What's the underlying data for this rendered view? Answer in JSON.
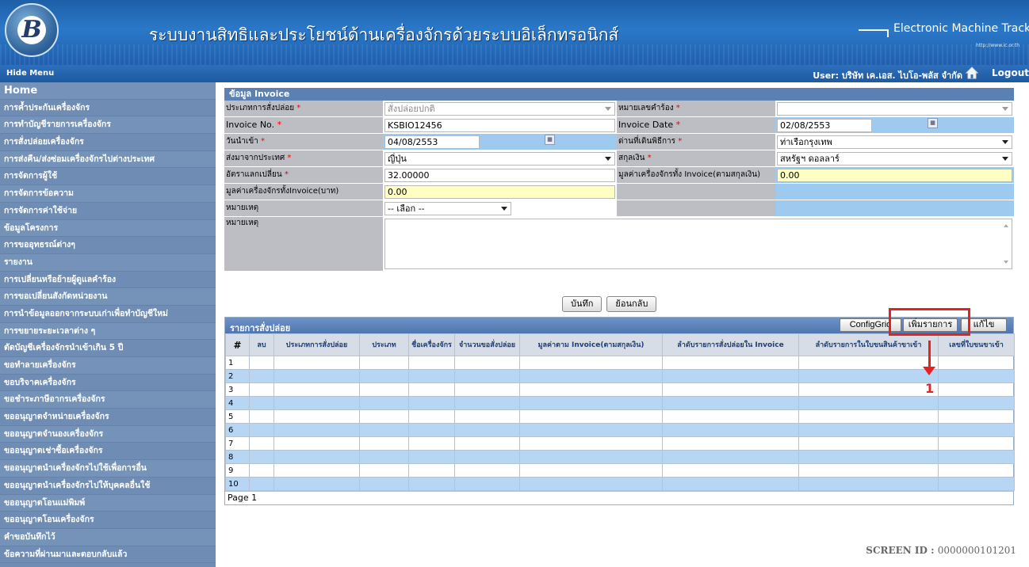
{
  "header": {
    "logo_text": "B",
    "title": "ระบบงานสิทธิและประโยชน์ด้านเครื่องจักรด้วยระบบอิเล็กทรอนิกส์",
    "brand": "Electronic Machine Tracking",
    "brand_url": "http://www.ic.or.th"
  },
  "menubar": {
    "hide_menu": "Hide Menu",
    "user": "User: บริษัท เค.เอส. ไบโอ-พลัส จำกัด",
    "logout": "Logout"
  },
  "sidebar": {
    "items": [
      "Home",
      "การค้ำประกันเครื่องจักร",
      "การทำบัญชีรายการเครื่องจักร",
      "การสั่งปล่อยเครื่องจักร",
      "การส่งคืน/ส่งซ่อมเครื่องจักรไปต่างประเทศ",
      "การจัดการผู้ใช้",
      "การจัดการข้อความ",
      "การจัดการค่าใช้จ่าย",
      "ข้อมูลโครงการ",
      "การขออุทธรณ์ต่างๆ",
      "รายงาน",
      "การเปลี่ยนหรือย้ายผู้ดูแลคำร้อง",
      "การขอเปลี่ยนสังกัดหน่วยงาน",
      "การนำข้อมูลออกจากระบบเก่าเพื่อทำบัญชีใหม่",
      "การขยายระยะเวลาต่าง ๆ",
      "ตัดบัญชีเครื่องจักรนำเข้าเกิน 5 ปี",
      "ขอทำลายเครื่องจักร",
      "ขอบริจาคเครื่องจักร",
      "ขอชำระภาษีอากรเครื่องจักร",
      "ขออนุญาตจำหน่ายเครื่องจักร",
      "ขออนุญาตจำนองเครื่องจักร",
      "ขออนุญาตเช่าซื้อเครื่องจักร",
      "ขออนุญาตนำเครื่องจักรไปใช้เพื่อการอื่น",
      "ขออนุญาตนำเครื่องจักรไปให้บุคคลอื่นใช้",
      "ขออนุญาตโอนแม่พิมพ์",
      "ขออนุญาตโอนเครื่องจักร",
      "คำขอบันทึกไว้",
      "ข้อความที่ผ่านมาและตอบกลับแล้ว"
    ]
  },
  "form": {
    "title": "ข้อมูล Invoice",
    "release_type_label": "ประเภทการสั่งปล่อย",
    "release_type_value": "สั่งปล่อยปกติ",
    "request_no_label": "หมายเลขคำร้อง",
    "request_no_value": "",
    "invoice_no_label": "Invoice No.",
    "invoice_no_value": "KSBIO12456",
    "invoice_date_label": "Invoice Date",
    "invoice_date_value": "02/08/2553",
    "import_date_label": "วันนำเข้า",
    "import_date_value": "04/08/2553",
    "customs_label": "ด่านที่เดินพิธีการ",
    "customs_value": "ท่าเรือกรุงเทพ",
    "from_country_label": "ส่งมาจากประเทศ",
    "from_country_value": "ญี่ปุ่น",
    "currency_label": "สกุลเงิน",
    "currency_value": "สหรัฐฯ ดอลลาร์",
    "exchange_rate_label": "อัตราแลกเปลี่ยน",
    "exchange_rate_value": "32.00000",
    "total_currency_label": "มูลค่าเครื่องจักรทั้ง Invoice(ตามสกุลเงิน)",
    "total_currency_value": "0.00",
    "total_baht_label": "มูลค่าเครื่องจักรทั้งInvoice(บาท)",
    "total_baht_value": "0.00",
    "remark_select_label": "หมายเหตุ",
    "remark_select_value": "-- เลือก --",
    "remark_text_label": "หมายเหตุ",
    "save_label": "บันทึก",
    "back_label": "ย้อนกลับ",
    "required_mark": "*"
  },
  "grid": {
    "title": "รายการสั่งปล่อย",
    "config_label": "ConfigGrid",
    "add_label": "เพิ่มรายการ",
    "edit_label": "แก้ไข",
    "columns": [
      "#",
      "ลบ",
      "ประเภทการสั่งปล่อย",
      "ประเภท",
      "ชื่อเครื่องจักร",
      "จำนวนขอสั่งปล่อย",
      "มูลค่าตาม Invoice(ตามสกุลเงิน)",
      "ลำดับรายการสั่งปล่อยใน Invoice",
      "ลำดับรายการในใบขนสินค้าขาเข้า",
      "เลขที่ใบขนขาเข้า"
    ],
    "rows": [
      "1",
      "2",
      "3",
      "4",
      "5",
      "6",
      "7",
      "8",
      "9",
      "10"
    ],
    "page": "Page 1"
  },
  "annotation": {
    "number": "1",
    "color": "#e52222"
  },
  "screen_id": {
    "label": "SCREEN ID :",
    "value": "0000000101201"
  }
}
